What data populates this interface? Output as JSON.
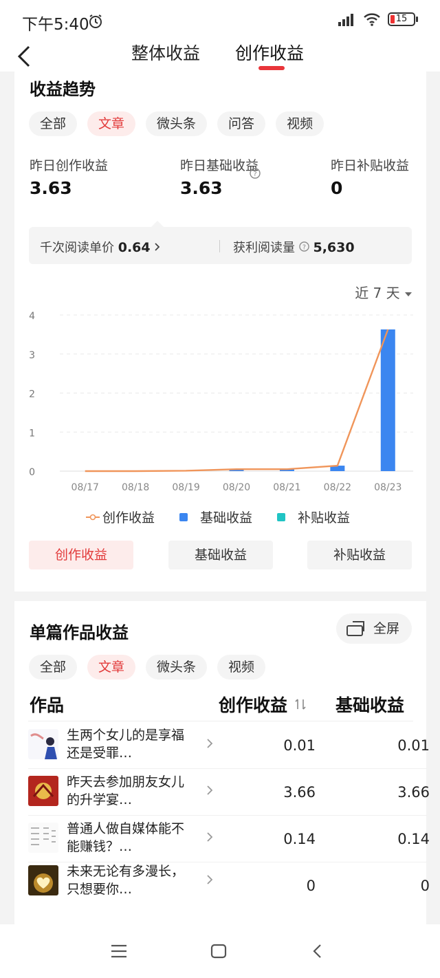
{
  "status": {
    "time": "下午5:40",
    "battery": "15"
  },
  "nav": {
    "tab_overall": "整体收益",
    "tab_creation": "创作收益"
  },
  "trend": {
    "title": "收益趋势",
    "chips": [
      "全部",
      "文章",
      "微头条",
      "问答",
      "视频"
    ],
    "active_chip": "文章",
    "metrics": [
      {
        "label": "昨日创作收益",
        "value": "3.63"
      },
      {
        "label": "昨日基础收益",
        "value": "3.63"
      },
      {
        "label": "昨日补贴收益",
        "value": "0"
      }
    ],
    "rpm_label": "千次阅读单价",
    "rpm_value": "0.64",
    "reads_label": "获利阅读量",
    "reads_value": "5,630",
    "range_label": "近 7 天",
    "legend": {
      "creation": "创作收益",
      "base": "基础收益",
      "subsidy": "补贴收益"
    },
    "buttons": [
      "创作收益",
      "基础收益",
      "补贴收益"
    ]
  },
  "chart_data": {
    "type": "bar",
    "categories": [
      "08/17",
      "08/18",
      "08/19",
      "08/20",
      "08/21",
      "08/22",
      "08/23"
    ],
    "series": [
      {
        "name": "基础收益",
        "type": "bar",
        "color": "#3b86f0",
        "values": [
          0,
          0,
          0.01,
          0.05,
          0.05,
          0.14,
          3.63
        ]
      },
      {
        "name": "补贴收益",
        "type": "bar",
        "color": "#20c4c4",
        "values": [
          0,
          0,
          0,
          0,
          0,
          0,
          0
        ]
      },
      {
        "name": "创作收益",
        "type": "line",
        "color": "#f0955a",
        "values": [
          0,
          0,
          0.01,
          0.05,
          0.05,
          0.14,
          3.63
        ]
      }
    ],
    "ylim": [
      0,
      4
    ],
    "yticks": [
      0,
      1,
      2,
      3,
      4
    ],
    "grid": true,
    "legend_position": "bottom"
  },
  "works": {
    "title": "单篇作品收益",
    "fullscreen": "全屏",
    "chips": [
      "全部",
      "文章",
      "微头条",
      "视频"
    ],
    "active_chip": "文章",
    "columns": [
      "作品",
      "创作收益",
      "基础收益"
    ],
    "rows": [
      {
        "title": "生两个女儿的是享福还是受罪…",
        "creation": "0.01",
        "base": "0.01"
      },
      {
        "title": "昨天去参加朋友女儿的升学宴…",
        "creation": "3.66",
        "base": "3.66"
      },
      {
        "title": "普通人做自媒体能不能赚钱？…",
        "creation": "0.14",
        "base": "0.14"
      },
      {
        "title": "未来无论有多漫长，只想要你…",
        "creation": "0",
        "base": "0"
      }
    ]
  },
  "colors": {
    "accent": "#e9353a",
    "bar": "#3b86f0",
    "line": "#f0955a",
    "subsidy": "#20c4c4"
  }
}
